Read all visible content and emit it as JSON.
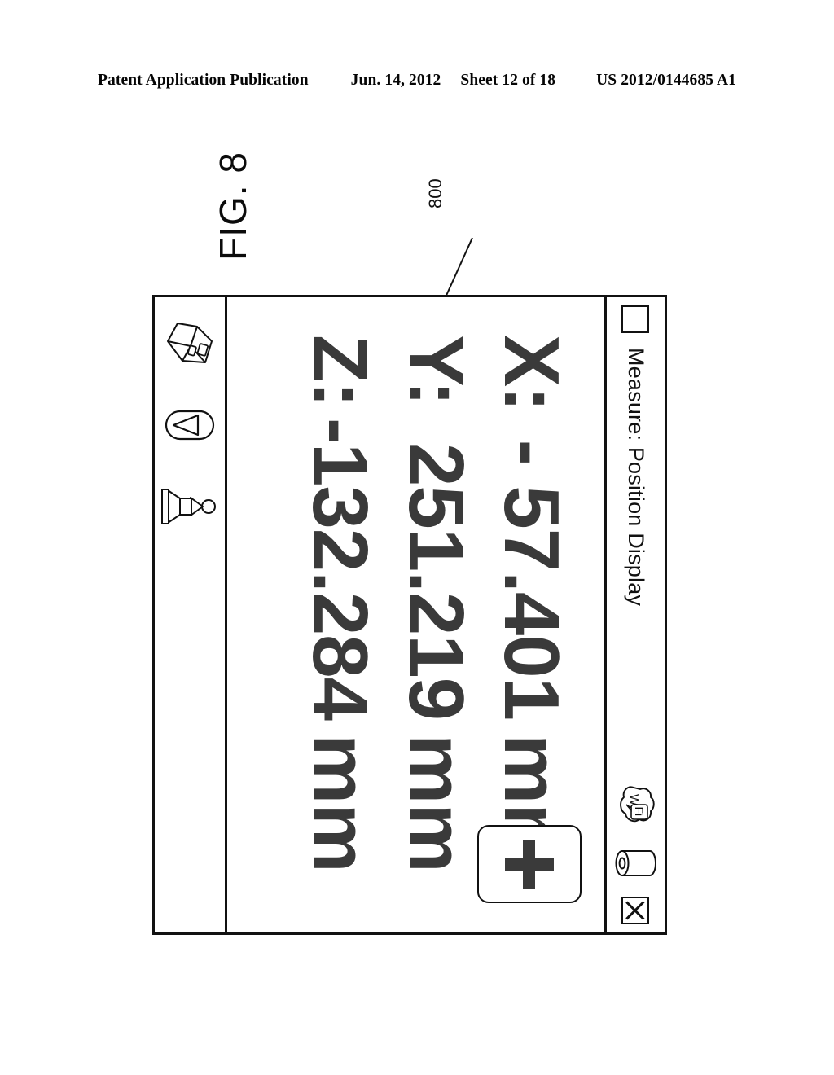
{
  "patent_header": {
    "publication": "Patent Application Publication",
    "date": "Jun. 14, 2012",
    "sheet": "Sheet 12 of 18",
    "number": "US 2012/0144685 A1"
  },
  "figure": {
    "label": "FIG. 8",
    "reference_numeral": "800"
  },
  "device": {
    "titlebar": {
      "title": "Measure: Position Display",
      "restore_button": "",
      "close_button": "X",
      "status_icons": [
        {
          "name": "wifi-icon",
          "label_1": "Wi",
          "label_2": "Fi"
        },
        {
          "name": "battery-icon",
          "label": ""
        }
      ]
    },
    "readouts": [
      {
        "axis": "X:",
        "value": "- 57.401",
        "unit": "mm"
      },
      {
        "axis": "Y:",
        "value": "251.219",
        "unit": "mm"
      },
      {
        "axis": "Z:",
        "value": "-132.284",
        "unit": "mm"
      }
    ],
    "add_button": {
      "glyph": "+"
    },
    "toolbar": [
      {
        "name": "probe-icon",
        "label": ""
      },
      {
        "name": "dropdown-triangle-icon",
        "label": ""
      },
      {
        "name": "part-model-icon",
        "label": ""
      }
    ]
  },
  "colors": {
    "ink": "#111111",
    "readout_gray": "#3a3a3a",
    "paper": "#ffffff"
  }
}
